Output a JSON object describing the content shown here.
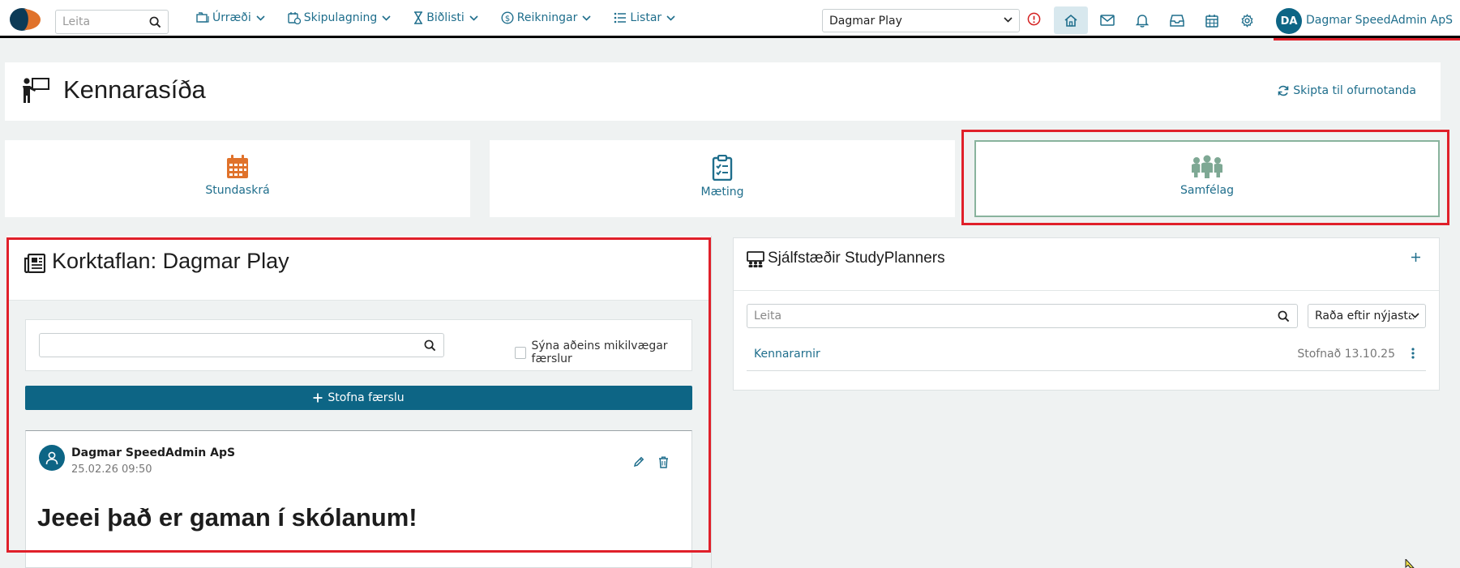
{
  "topbar": {
    "search_placeholder": "Leita",
    "menu": [
      {
        "label": "Úrræði",
        "icon": "folders-icon"
      },
      {
        "label": "Skipulagning",
        "icon": "calendar-clock-icon"
      },
      {
        "label": "Biðlisti",
        "icon": "hourglass-icon"
      },
      {
        "label": "Reikningar",
        "icon": "dollar-circle-icon"
      },
      {
        "label": "Listar",
        "icon": "list-icon"
      }
    ],
    "school_selected": "Dagmar Play",
    "user_initials": "DA",
    "user_name": "Dagmar SpeedAdmin ApS"
  },
  "page": {
    "title": "Kennarasíða",
    "switch_label": "Skipta til ofurnotanda"
  },
  "tiles": [
    {
      "label": "Stundaskrá",
      "icon": "calendar-icon",
      "color": "#e0722b"
    },
    {
      "label": "Mæting",
      "icon": "clipboard-check-icon",
      "color": "#1f6e8c"
    },
    {
      "label": "Samfélag",
      "icon": "community-icon",
      "color": "#7ea894"
    }
  ],
  "corkboard": {
    "title": "Korktaflan: Dagmar Play",
    "search_placeholder": "",
    "important_only_label": "Sýna aðeins mikilvægar færslur",
    "create_label": "Stofna færslu",
    "post": {
      "author": "Dagmar SpeedAdmin ApS",
      "date": "25.02.26 09:50",
      "text": "Jeeei það er gaman í skólanum!"
    }
  },
  "studyplanners": {
    "title": "Sjálfstæðir StudyPlanners",
    "search_placeholder": "Leita",
    "sort_label": "Raða eftir nýjasta",
    "rows": [
      {
        "name": "Kennararnir",
        "created": "Stofnað 13.10.25"
      }
    ]
  },
  "colors": {
    "primary": "#0d6585",
    "link": "#1f6e8c",
    "accent_orange": "#e0722b",
    "selected_green": "#89b39d",
    "highlight_red": "#e0202a"
  }
}
